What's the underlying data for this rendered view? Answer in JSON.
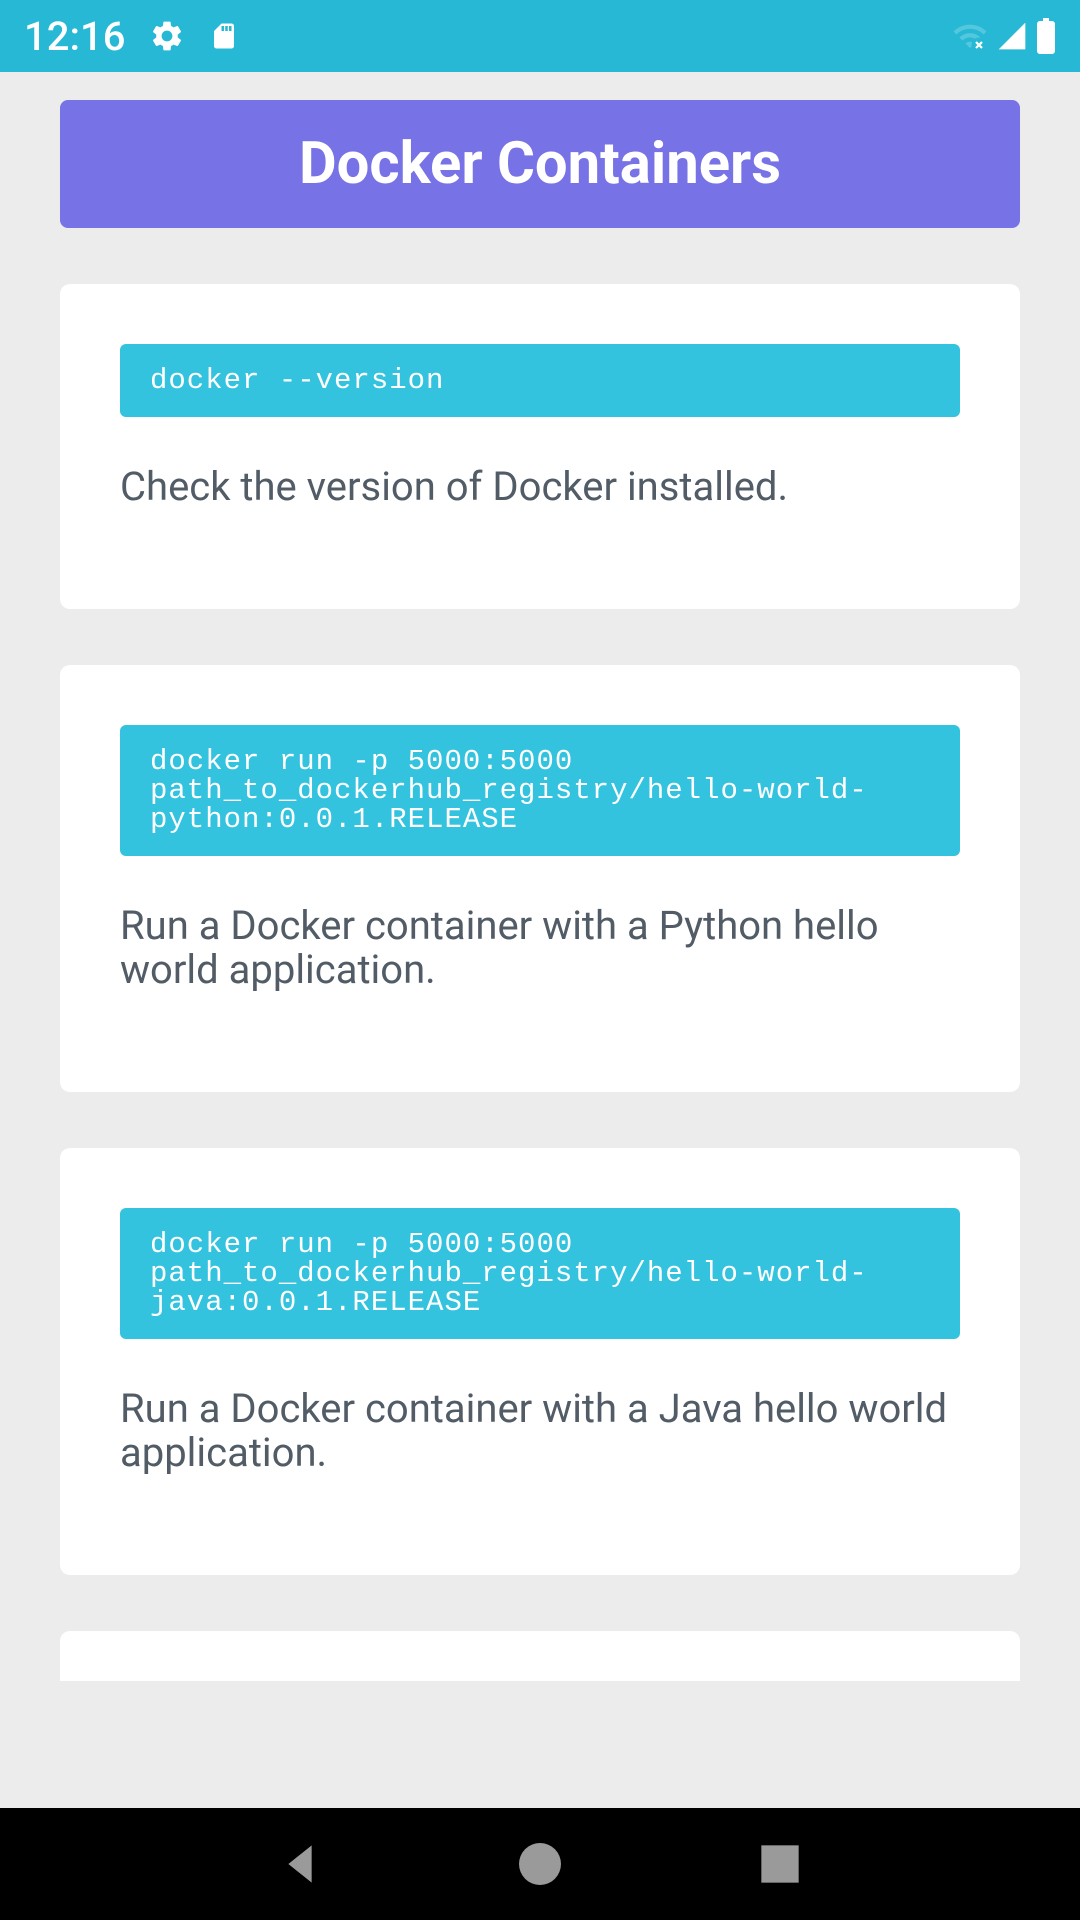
{
  "status_bar": {
    "time": "12:16"
  },
  "header": {
    "title": "Docker Containers"
  },
  "cards": [
    {
      "command": "docker --version",
      "description": "Check the version of Docker installed."
    },
    {
      "command": "docker run -p 5000:5000 path_to_dockerhub_registry/hello-world-python:0.0.1.RELEASE",
      "description": "Run a Docker container with a Python hello world application."
    },
    {
      "command": "docker run -p 5000:5000 path_to_dockerhub_registry/hello-world-java:0.0.1.RELEASE",
      "description": "Run a Docker container with a Java hello world application."
    }
  ],
  "colors": {
    "status_bar": "#26b8d4",
    "header_banner": "#7772e6",
    "code_block": "#33c3df",
    "text_dark": "#525c66"
  }
}
